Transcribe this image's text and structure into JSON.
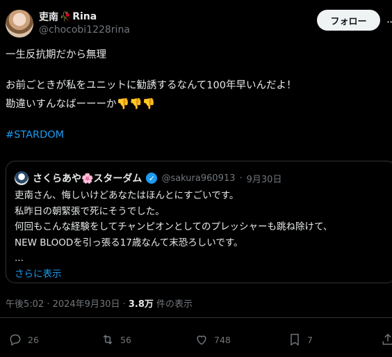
{
  "author": {
    "name": "吏南",
    "name_suffix": "Rina",
    "flower_emoji": "🥀",
    "handle": "@chocobi1228rina"
  },
  "buttons": {
    "follow": "フォロー",
    "more": "···"
  },
  "tweet": {
    "line1": "一生反抗期だから無理",
    "line2": "お前ごときが私をユニットに勧誘するなんて100年早いんだよ！",
    "line3": "勘違いすんなばーーーか",
    "thumbs": "👎👎👎",
    "hashtag": "#STARDOM"
  },
  "quote": {
    "name": "さくらあや🌸スターダム",
    "handle": "@sakura960913",
    "sep": "·",
    "date": "9月30日",
    "lines": [
      "吏南さん、悔しいけどあなたはほんとにすごいです。",
      "私昨日の朝緊張で死にそうでした。",
      "何回もこんな経験をしてチャンピオンとしてのプレッシャーも跳ね除けて、",
      "NEW BLOODを引っ張る17歳なんて末恐ろしいです。",
      "..."
    ],
    "show_more": "さらに表示"
  },
  "meta": {
    "time": "午後5:02 · 2024年9月30日 · ",
    "views": "3.8万",
    "views_label": " 件の表示"
  },
  "actions": {
    "replies": "26",
    "retweets": "56",
    "likes": "748",
    "bookmarks": "7"
  }
}
